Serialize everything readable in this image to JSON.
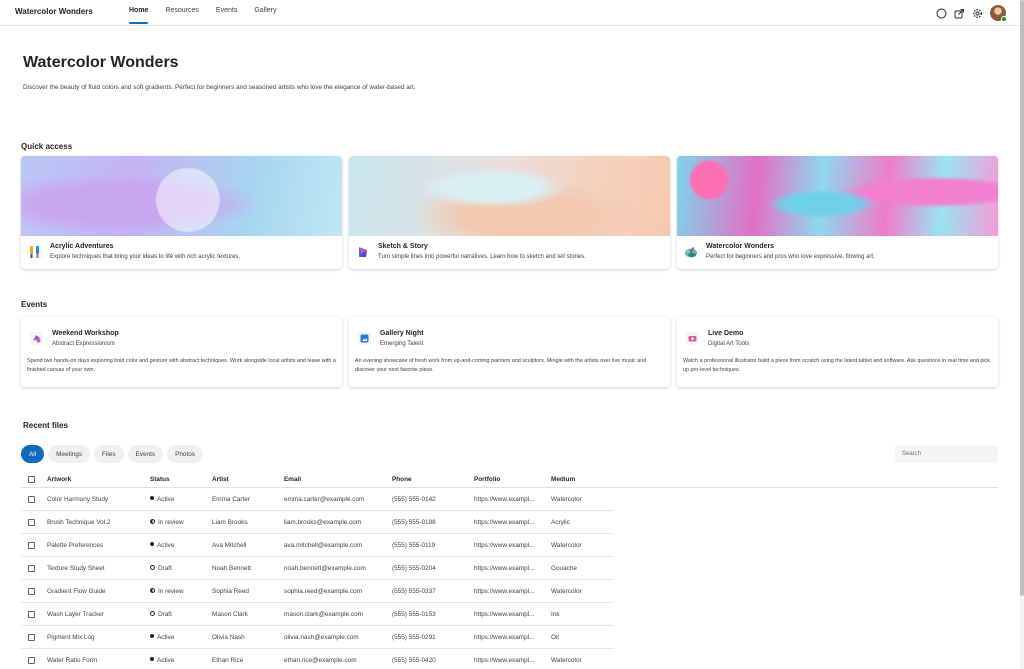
{
  "app": {
    "brand": "Watercolor Wonders"
  },
  "nav": {
    "items": [
      {
        "label": "Home",
        "active": true
      },
      {
        "label": "Resources",
        "active": false
      },
      {
        "label": "Events",
        "active": false
      },
      {
        "label": "Gallery",
        "active": false
      }
    ]
  },
  "hero": {
    "title": "Watercolor Wonders",
    "subtitle": "Discover the beauty of fluid colors and soft gradients. Perfect for beginners and seasoned artists who love the elegance of water-based art."
  },
  "quick_access": {
    "title": "Quick access",
    "cards": [
      {
        "title": "Acrylic Adventures",
        "desc": "Explore techniques that bring your ideas to life with rich acrylic textures.",
        "icon": "paint-brushes-icon"
      },
      {
        "title": "Sketch & Story",
        "desc": "Turn simple lines into powerful narratives. Learn how to sketch and tell stories.",
        "icon": "sketch-app-icon"
      },
      {
        "title": "Watercolor Wonders",
        "desc": "Perfect for beginners and pros who love expressive, flowing art.",
        "icon": "palette-icon"
      }
    ]
  },
  "events": {
    "title": "Events",
    "cards": [
      {
        "title": "Weekend Workshop",
        "subtitle": "Abstract Expressionism",
        "desc": "Spend two hands-on days exploring bold color and gesture with abstract techniques. Work alongside local artists and leave with a finished canvas of your own.",
        "icon": "workshop-icon"
      },
      {
        "title": "Gallery Night",
        "subtitle": "Emerging Talent",
        "desc": "An evening showcase of fresh work from up-and-coming painters and sculptors. Mingle with the artists over live music and discover your next favorite piece.",
        "icon": "gallery-icon"
      },
      {
        "title": "Live Demo",
        "subtitle": "Digital Art Tools",
        "desc": "Watch a professional illustrator build a piece from scratch using the latest tablet and software. Ask questions in real time and pick up pro-level techniques.",
        "icon": "demo-icon"
      }
    ]
  },
  "recent_files": {
    "title": "Recent files",
    "filters": [
      "All",
      "Meetings",
      "Files",
      "Events",
      "Photos"
    ],
    "active_filter": "All",
    "search_placeholder": "Search",
    "columns": [
      "Artwork",
      "Status",
      "Artist",
      "Email",
      "Phone",
      "Portfolio",
      "Medium"
    ],
    "rows": [
      {
        "artwork": "Color Harmony Study",
        "status": "Active",
        "status_kind": "active",
        "artist": "Emma Carter",
        "email": "emma.carter@example.com",
        "phone": "(555) 555-0142",
        "portfolio": "https://www.exampl...",
        "medium": "Watercolor"
      },
      {
        "artwork": "Brush Technique Vol.2",
        "status": "In review",
        "status_kind": "review",
        "artist": "Liam Brooks",
        "email": "liam.brooks@example.com",
        "phone": "(555) 555-0188",
        "portfolio": "https://www.exampl...",
        "medium": "Acrylic"
      },
      {
        "artwork": "Palette Preferences",
        "status": "Active",
        "status_kind": "active",
        "artist": "Ava Mitchell",
        "email": "ava.mitchell@example.com",
        "phone": "(555) 555-0119",
        "portfolio": "https://www.exampl...",
        "medium": "Watercolor"
      },
      {
        "artwork": "Texture Study Sheet",
        "status": "Draft",
        "status_kind": "draft",
        "artist": "Noah Bennett",
        "email": "noah.bennett@example.com",
        "phone": "(555) 555-0204",
        "portfolio": "https://www.exampl...",
        "medium": "Gouache"
      },
      {
        "artwork": "Gradient Flow Guide",
        "status": "In review",
        "status_kind": "review",
        "artist": "Sophia Reed",
        "email": "sophia.reed@example.com",
        "phone": "(555) 555-0337",
        "portfolio": "https://www.exampl...",
        "medium": "Watercolor"
      },
      {
        "artwork": "Wash Layer Tracker",
        "status": "Draft",
        "status_kind": "draft",
        "artist": "Mason Clark",
        "email": "mason.clark@example.com",
        "phone": "(555) 555-0153",
        "portfolio": "https://www.exampl...",
        "medium": "Ink"
      },
      {
        "artwork": "Pigment Mix Log",
        "status": "Active",
        "status_kind": "active",
        "artist": "Olivia Nash",
        "email": "olivia.nash@example.com",
        "phone": "(555) 555-0291",
        "portfolio": "https://www.exampl...",
        "medium": "Oil"
      },
      {
        "artwork": "Water Ratio Form",
        "status": "Active",
        "status_kind": "active",
        "artist": "Ethan Rice",
        "email": "ethan.rice@example.com",
        "phone": "(555) 555-0420",
        "portfolio": "https://www.exampl...",
        "medium": "Watercolor"
      }
    ]
  },
  "colors": {
    "accent": "#0f6cbd",
    "text": "#242424",
    "muted": "#424242",
    "presence": "#13a10e"
  },
  "top_icons": [
    "circle-icon",
    "share-icon",
    "gear-icon",
    "avatar"
  ]
}
